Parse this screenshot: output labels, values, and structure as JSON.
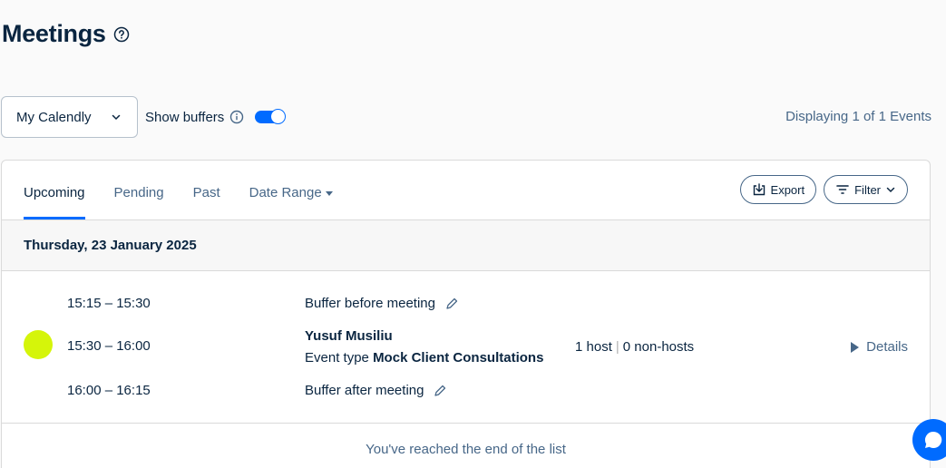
{
  "header": {
    "title": "Meetings",
    "help_icon": "help-circle-icon"
  },
  "controls": {
    "calendar_select": "My Calendly",
    "show_buffers_label": "Show buffers",
    "show_buffers_on": true,
    "displaying": "Displaying 1 of 1 Events"
  },
  "tabs": [
    {
      "label": "Upcoming",
      "active": true
    },
    {
      "label": "Pending",
      "active": false
    },
    {
      "label": "Past",
      "active": false
    },
    {
      "label": "Date Range",
      "active": false
    }
  ],
  "actions": {
    "export_label": "Export",
    "filter_label": "Filter"
  },
  "date_group": "Thursday, 23 January 2025",
  "event": {
    "buffer_before": {
      "time": "15:15 – 15:30",
      "label": "Buffer before meeting"
    },
    "meeting": {
      "time": "15:30 – 16:00",
      "invitee": "Yusuf Musiliu",
      "event_type_prefix": "Event type",
      "event_type_name": "Mock Client Consultations",
      "hosts": "1 host",
      "non_hosts": "0 non-hosts",
      "details_label": "Details",
      "color": "#d5f50a"
    },
    "buffer_after": {
      "time": "16:00 – 16:15",
      "label": "Buffer after meeting"
    }
  },
  "end_of_list": "You've reached the end of the list",
  "colors": {
    "accent": "#006bff",
    "text": "#0a2540",
    "muted": "#476788"
  }
}
